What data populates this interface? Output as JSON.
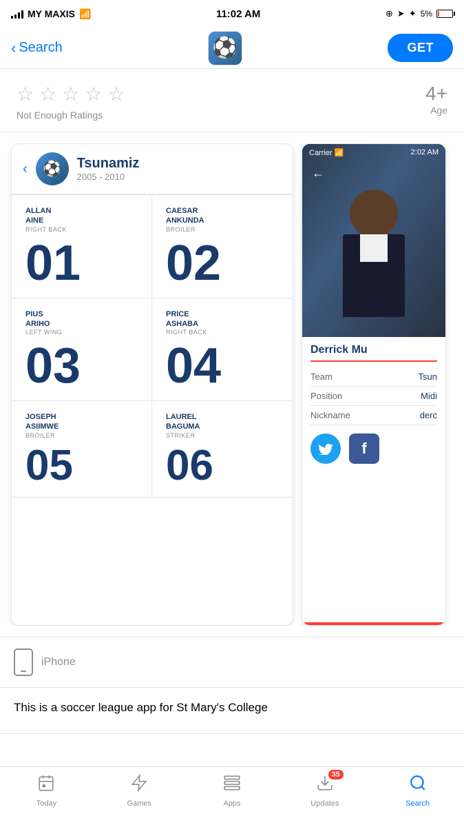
{
  "statusBar": {
    "carrier": "MY MAXIS",
    "time": "11:02 AM",
    "battery_percent": "5%"
  },
  "navBar": {
    "back_label": "Search",
    "get_label": "GET"
  },
  "rating": {
    "stars_empty": [
      "★",
      "★",
      "★",
      "★",
      "★"
    ],
    "rating_label": "Not Enough Ratings",
    "age_value": "4+",
    "age_label": "Age"
  },
  "screenshots": [
    {
      "id": "screen1",
      "team_name": "Tsunamiz",
      "team_years": "2005 - 2010",
      "players": [
        {
          "name": "ALLAN\nAINE",
          "position": "RIGHT BACK",
          "number": "01"
        },
        {
          "name": "CAESAR\nANKUNDA",
          "position": "BROILER",
          "number": "02"
        },
        {
          "name": "PIUS\nARIHO",
          "position": "LEFT WING",
          "number": "03"
        },
        {
          "name": "PRICE\nASHABA",
          "position": "RIGHT BACK",
          "number": "04"
        },
        {
          "name": "JOSEPH\nASIIMWE",
          "position": "BROILER",
          "number": "05"
        },
        {
          "name": "LAUREL\nBAGUMA",
          "position": "STRIKER",
          "number": "06"
        }
      ]
    },
    {
      "id": "screen2",
      "status_time": "2:02 AM",
      "player_name": "Derrick Mu",
      "info_rows": [
        {
          "key": "Team",
          "value": "Tsun"
        },
        {
          "key": "Position",
          "value": "Midi"
        },
        {
          "key": "Nickname",
          "value": "derc"
        }
      ]
    }
  ],
  "device": {
    "label": "iPhone"
  },
  "description": {
    "text": "This is a soccer league app for St Mary's College"
  },
  "tabBar": {
    "items": [
      {
        "id": "today",
        "label": "Today",
        "icon": "📱",
        "active": false
      },
      {
        "id": "games",
        "label": "Games",
        "icon": "🚀",
        "active": false
      },
      {
        "id": "apps",
        "label": "Apps",
        "icon": "🗂️",
        "active": false
      },
      {
        "id": "updates",
        "label": "Updates",
        "icon": "⬇️",
        "active": false,
        "badge": "35"
      },
      {
        "id": "search",
        "label": "Search",
        "icon": "🔍",
        "active": true
      }
    ]
  }
}
